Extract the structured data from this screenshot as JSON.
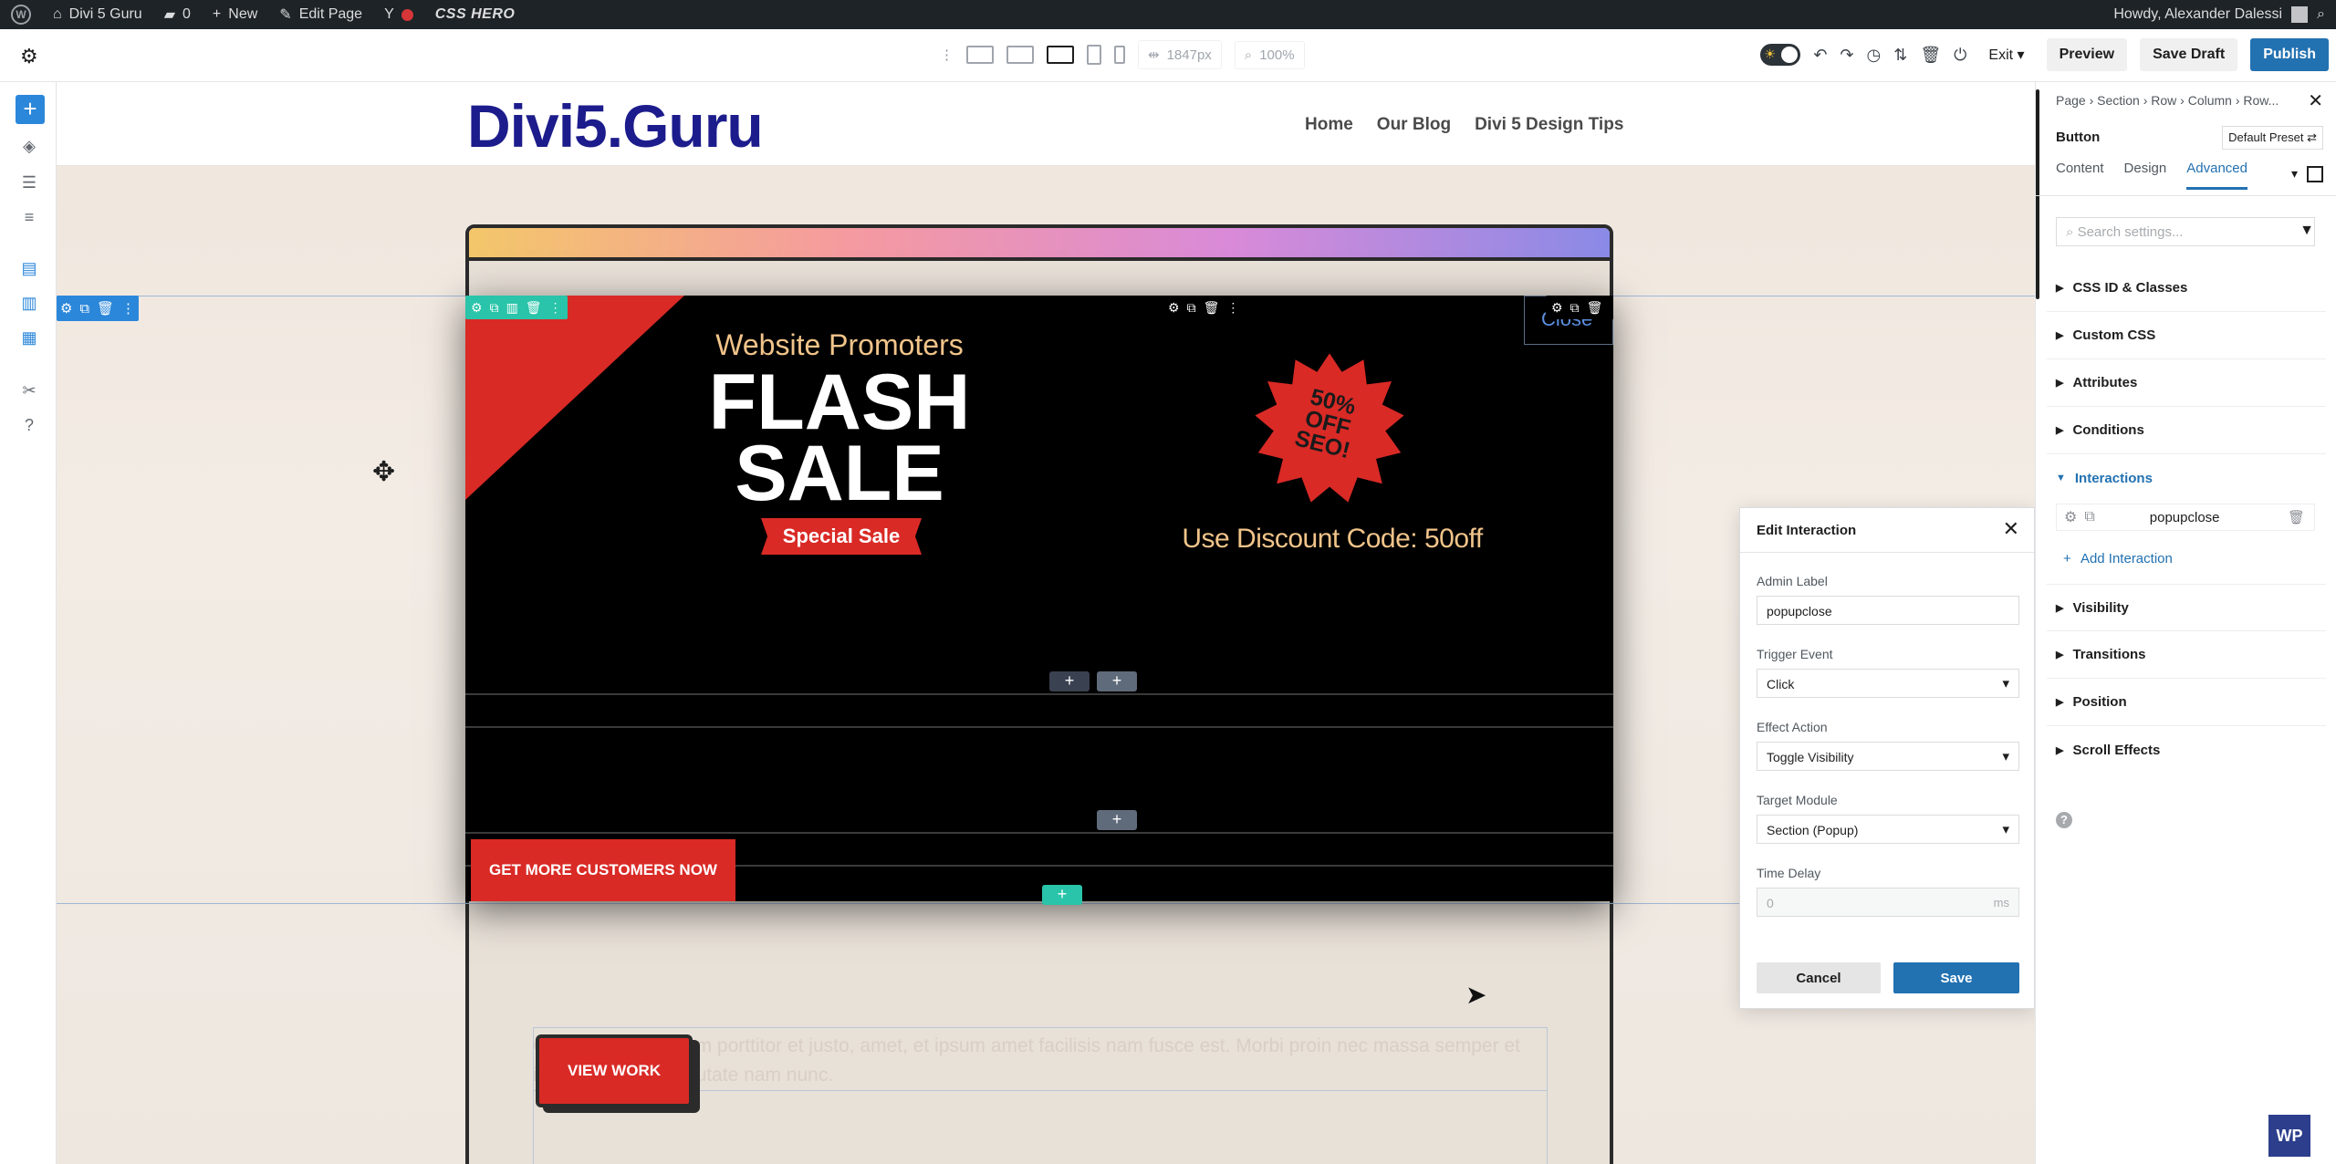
{
  "wp_admin_bar": {
    "site_name": "Divi 5 Guru",
    "comments_count": "0",
    "new_label": "New",
    "edit_page_label": "Edit Page",
    "yoast_label": "Y",
    "css_hero_label": "CSS HERO",
    "howdy": "Howdy, Alexander Dalessi"
  },
  "toolbar": {
    "width_value": "1847px",
    "zoom_value": "100%",
    "exit_label": "Exit",
    "preview_label": "Preview",
    "save_draft_label": "Save Draft",
    "publish_label": "Publish"
  },
  "site": {
    "logo": "Divi5.Guru",
    "nav": [
      "Home",
      "Our Blog",
      "Divi 5 Design Tips"
    ]
  },
  "popup": {
    "promoters": "Website Promoters",
    "flash_line1": "FLASH",
    "flash_line2": "SALE",
    "special_sale": "Special Sale",
    "badge_line1": "50%",
    "badge_line2": "OFF",
    "badge_line3": "SEO!",
    "discount_code": "Use Discount Code: 50off",
    "close_label": "Close",
    "cta_label": "GET MORE CUSTOMERS NOW"
  },
  "page_behind": {
    "paragraph": "Curabitur elementum porttitor et justo, amet, et ipsum amet facilisis nam fusce est. Morbi proin nec massa semper et ipsum tellus et vulputate nam nunc.",
    "view_work_label": "VIEW WORK"
  },
  "edit_interaction": {
    "title": "Edit Interaction",
    "admin_label_label": "Admin Label",
    "admin_label_value": "popupclose",
    "trigger_event_label": "Trigger Event",
    "trigger_event_value": "Click",
    "effect_action_label": "Effect Action",
    "effect_action_value": "Toggle Visibility",
    "target_module_label": "Target Module",
    "target_module_value": "Section (Popup)",
    "time_delay_label": "Time Delay",
    "time_delay_value": "0",
    "time_delay_unit": "ms",
    "cancel_label": "Cancel",
    "save_label": "Save"
  },
  "settings_panel": {
    "breadcrumb": "Page › Section › Row › Column › Row...",
    "module_title": "Button",
    "preset_label": "Default Preset",
    "tabs": [
      "Content",
      "Design",
      "Advanced"
    ],
    "active_tab": "Advanced",
    "search_placeholder": "Search settings...",
    "groups": [
      "CSS ID & Classes",
      "Custom CSS",
      "Attributes",
      "Conditions",
      "Interactions",
      "Visibility",
      "Transitions",
      "Position",
      "Scroll Effects"
    ],
    "interaction_item": "popupclose",
    "add_interaction_label": "Add Interaction"
  },
  "colors": {
    "accent": "#2271b1",
    "popup_red": "#d92a26",
    "logo_blue": "#1c1c8c",
    "builder_green": "#29c4a9"
  }
}
